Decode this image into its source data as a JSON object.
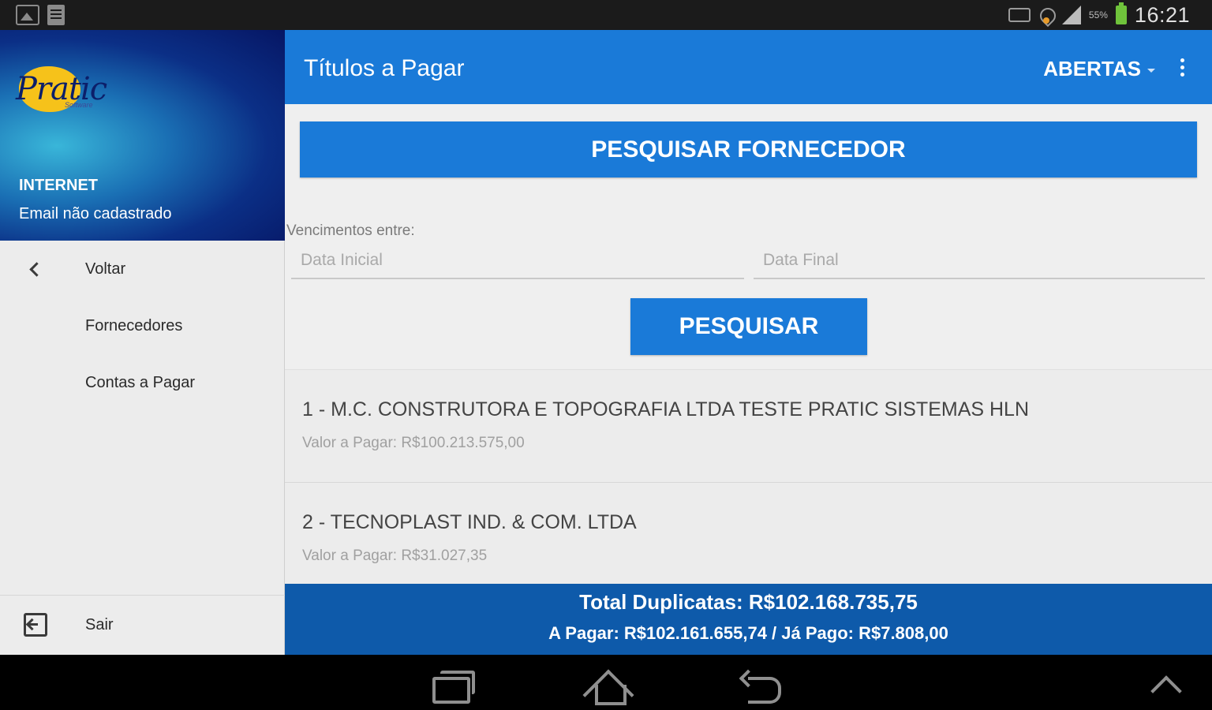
{
  "status_bar": {
    "battery_pct": "55%",
    "time": "16:21",
    "icons": [
      "image-icon",
      "document-icon",
      "mute-icon",
      "wifi-icon",
      "signal-icon",
      "battery-icon"
    ]
  },
  "drawer": {
    "logo": {
      "text": "Pratic",
      "subtext": "Software"
    },
    "user_name": "INTERNET",
    "user_email": "Email não cadastrado",
    "items": [
      {
        "label": "Voltar",
        "icon": "chevron-left-icon"
      },
      {
        "label": "Fornecedores"
      },
      {
        "label": "Contas a Pagar"
      }
    ],
    "footer_item": {
      "label": "Sair",
      "icon": "exit-icon"
    }
  },
  "action_bar": {
    "title": "Títulos a Pagar",
    "filter_selected": "ABERTAS",
    "overflow_icon": "overflow-menu-icon"
  },
  "search": {
    "supplier_button_label": "PESQUISAR FORNECEDOR",
    "due_label": "Vencimentos entre:",
    "start_placeholder": "Data Inicial",
    "end_placeholder": "Data Final",
    "search_button_label": "PESQUISAR"
  },
  "list": [
    {
      "title": "1 - M.C. CONSTRUTORA E TOPOGRAFIA LTDA TESTE PRATIC SISTEMAS HLN",
      "subtitle": "Valor  a Pagar: R$100.213.575,00"
    },
    {
      "title": "2 - TECNOPLAST IND. & COM. LTDA",
      "subtitle": "Valor  a Pagar: R$31.027,35"
    }
  ],
  "totals": {
    "line1": "Total Duplicatas: R$102.168.735,75",
    "line2": "A Pagar: R$102.161.655,74 / Já Pago: R$7.808,00"
  },
  "colors": {
    "primary": "#1a7ad8",
    "totals_bg": "#0e5aaa",
    "drawer_bg": "#ececec"
  }
}
